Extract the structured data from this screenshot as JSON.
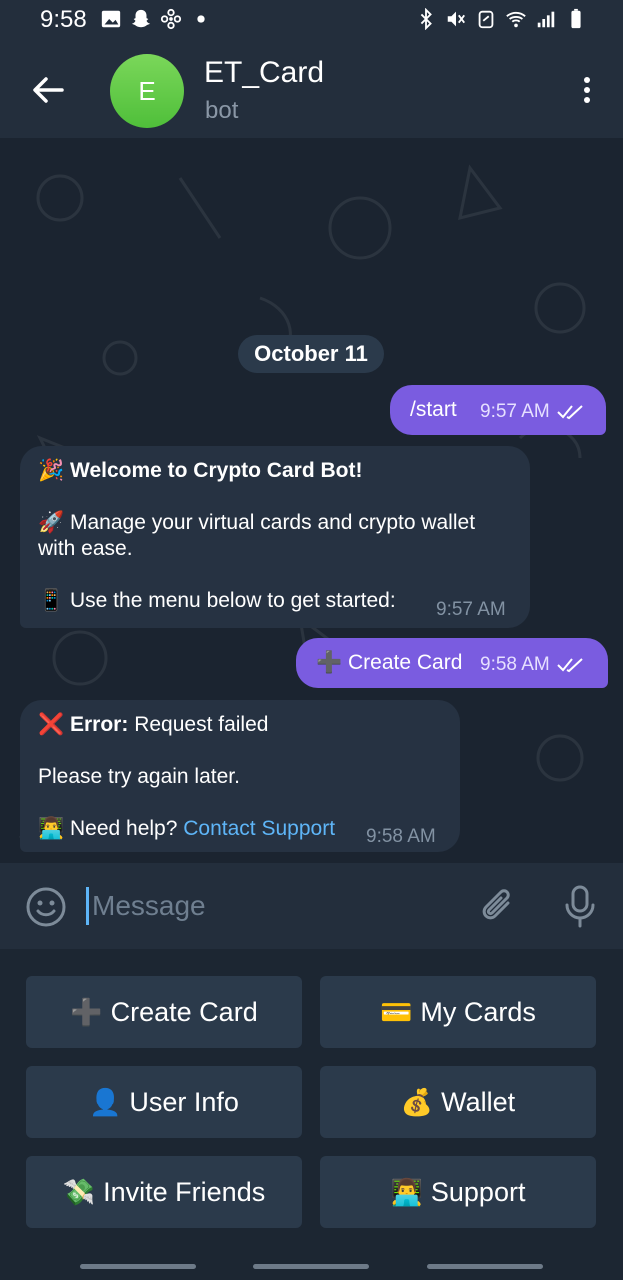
{
  "status_bar": {
    "time": "9:58",
    "left_icons": [
      "image-icon",
      "snapchat-icon",
      "fan-icon",
      "dot-icon"
    ],
    "right_icons": [
      "bluetooth-icon",
      "mute-icon",
      "battery-saver-icon",
      "wifi-icon",
      "signal-icon",
      "battery-icon"
    ]
  },
  "header": {
    "avatar_letter": "E",
    "title": "ET_Card",
    "subtitle": "bot"
  },
  "chat": {
    "date": "October 11",
    "messages": [
      {
        "dir": "out",
        "text": "/start",
        "time": "9:57 AM"
      },
      {
        "dir": "in",
        "line1_emoji": "🎉",
        "line1": "Welcome to Crypto Card Bot!",
        "line2_emoji": "🚀",
        "line2": "Manage your virtual cards and crypto wallet with ease.",
        "line3_emoji": "📱",
        "line3": "Use the menu below to get started:",
        "time": "9:57 AM"
      },
      {
        "dir": "out",
        "emoji": "➕",
        "text": "Create Card",
        "time": "9:58 AM"
      },
      {
        "dir": "in",
        "error_emoji": "❌",
        "error_label": "Error:",
        "error_text": "Request failed",
        "retry": "Please try again later.",
        "help_emoji": "👨‍💻",
        "help_text": "Need help?",
        "help_link": "Contact Support",
        "time": "9:58 AM"
      }
    ]
  },
  "composer": {
    "placeholder": "Message"
  },
  "keyboard": {
    "buttons": [
      {
        "emoji": "➕",
        "label": "Create Card"
      },
      {
        "emoji": "💳",
        "label": "My Cards"
      },
      {
        "emoji": "👤",
        "label": "User Info"
      },
      {
        "emoji": "💰",
        "label": "Wallet"
      },
      {
        "emoji": "💸",
        "label": "Invite Friends"
      },
      {
        "emoji": "👨‍💻",
        "label": "Support"
      }
    ]
  },
  "colors": {
    "outgoing_bubble": "#7a5ce0",
    "incoming_bubble": "#263242",
    "link": "#5eb5f7",
    "avatar": "#5cc447"
  }
}
